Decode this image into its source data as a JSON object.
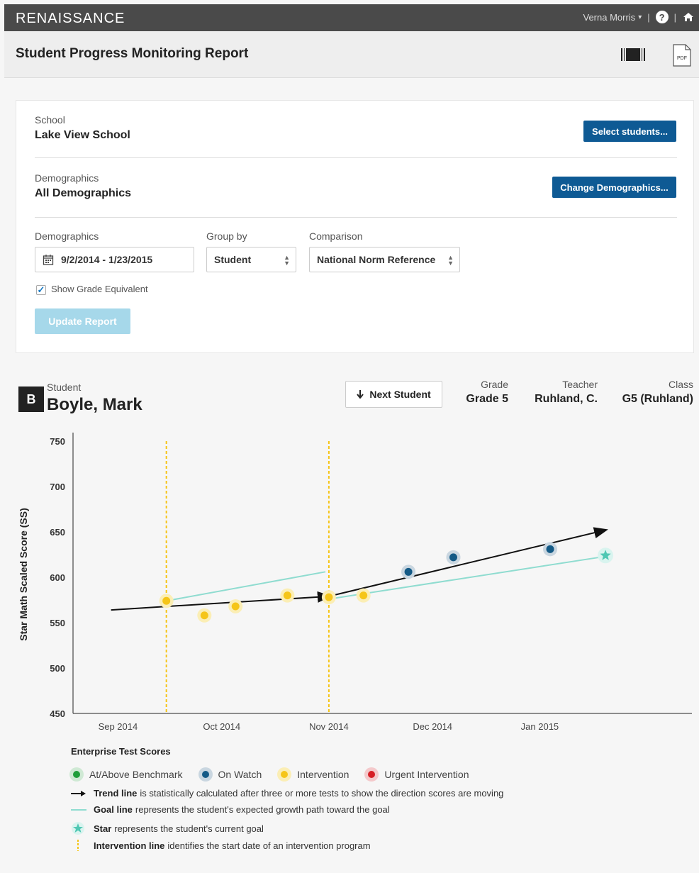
{
  "header": {
    "brand": "RENAISSANCE",
    "user_name": "Verna Morris",
    "help_icon": "question-circle-icon",
    "home_icon": "home-icon"
  },
  "page": {
    "title": "Student Progress Monitoring Report"
  },
  "filters": {
    "school_label": "School",
    "school_value": "Lake View School",
    "select_students_button": "Select students...",
    "demographics_label": "Demographics",
    "demographics_value": "All Demographics",
    "change_demographics_button": "Change Demographics...",
    "date_range_label": "Demographics",
    "date_range_value": "9/2/2014 - 1/23/2015",
    "group_by_label": "Group by",
    "group_by_value": "Student",
    "comparison_label": "Comparison",
    "comparison_value": "National Norm Reference",
    "show_ge_label": "Show Grade Equivalent",
    "show_ge_checked": true,
    "update_button": "Update Report"
  },
  "student": {
    "badge": "B",
    "label": "Student",
    "name": "Boyle, Mark",
    "next_button": "Next Student",
    "grade_label": "Grade",
    "grade_value": "Grade 5",
    "teacher_label": "Teacher",
    "teacher_value": "Ruhland, C.",
    "class_label": "Class",
    "class_value": "G5 (Ruhland)"
  },
  "chart_data": {
    "type": "scatter",
    "ylabel": "Star Math Scaled Score (SS)",
    "ylim": [
      450,
      750
    ],
    "yticks": [
      450,
      500,
      550,
      600,
      650,
      700,
      750
    ],
    "xlim": [
      "2014-08-19",
      "2015-02-14"
    ],
    "xticks": [
      {
        "date": "2014-09-01",
        "label": "Sep 2014"
      },
      {
        "date": "2014-10-01",
        "label": "Oct 2014"
      },
      {
        "date": "2014-11-01",
        "label": "Nov 2014"
      },
      {
        "date": "2014-12-01",
        "label": "Dec 2014"
      },
      {
        "date": "2015-01-01",
        "label": "Jan 2015"
      }
    ],
    "points": [
      {
        "date": "2014-09-15",
        "score": 574,
        "status": "Intervention"
      },
      {
        "date": "2014-09-26",
        "score": 558,
        "status": "Intervention"
      },
      {
        "date": "2014-10-05",
        "score": 568,
        "status": "Intervention"
      },
      {
        "date": "2014-10-20",
        "score": 580,
        "status": "Intervention"
      },
      {
        "date": "2014-11-01",
        "score": 578,
        "status": "Intervention"
      },
      {
        "date": "2014-11-11",
        "score": 580,
        "status": "Intervention"
      },
      {
        "date": "2014-11-24",
        "score": 606,
        "status": "On Watch"
      },
      {
        "date": "2014-12-07",
        "score": 622,
        "status": "On Watch"
      },
      {
        "date": "2015-01-04",
        "score": 631,
        "status": "On Watch"
      }
    ],
    "trend_lines": [
      {
        "from": {
          "date": "2014-08-30",
          "score": 564
        },
        "to": {
          "date": "2014-11-01",
          "score": 579
        }
      },
      {
        "from": {
          "date": "2014-11-01",
          "score": 579
        },
        "to": {
          "date": "2015-01-20",
          "score": 652
        }
      }
    ],
    "goal_lines": [
      {
        "from": {
          "date": "2014-09-15",
          "score": 574
        },
        "to": {
          "date": "2014-10-31",
          "score": 606
        }
      },
      {
        "from": {
          "date": "2014-11-01",
          "score": 576
        },
        "to": {
          "date": "2015-01-20",
          "score": 623
        }
      }
    ],
    "goal_star": {
      "date": "2015-01-20",
      "score": 624
    },
    "intervention_dates": [
      "2014-09-15",
      "2014-11-01"
    ],
    "status_colors": {
      "At/Above Benchmark": "#1f9e3a",
      "On Watch": "#145a86",
      "Intervention": "#f5c518",
      "Urgent Intervention": "#d61f26"
    },
    "trend_color": "#111111",
    "goal_color": "#8fdcd0",
    "intervention_color": "#f5c518"
  },
  "legend": {
    "title": "Enterprise Test Scores",
    "statuses": [
      {
        "label": "At/Above Benchmark",
        "color": "#1f9e3a",
        "halo": "#cfe9d4"
      },
      {
        "label": "On Watch",
        "color": "#145a86",
        "halo": "#c9d6e0"
      },
      {
        "label": "Intervention",
        "color": "#f5c518",
        "halo": "#fbeeb5"
      },
      {
        "label": "Urgent Intervention",
        "color": "#d61f26",
        "halo": "#f4c9cb"
      }
    ],
    "trend_bold": "Trend line",
    "trend_text": "is statistically calculated after three or more tests to show the direction scores are moving",
    "goal_bold": "Goal line",
    "goal_text": "represents the student's expected growth path toward the goal",
    "star_bold": "Star",
    "star_text": "represents the student's current goal",
    "intervention_bold": "Intervention line",
    "intervention_text": "identifies the start date of an intervention program"
  }
}
